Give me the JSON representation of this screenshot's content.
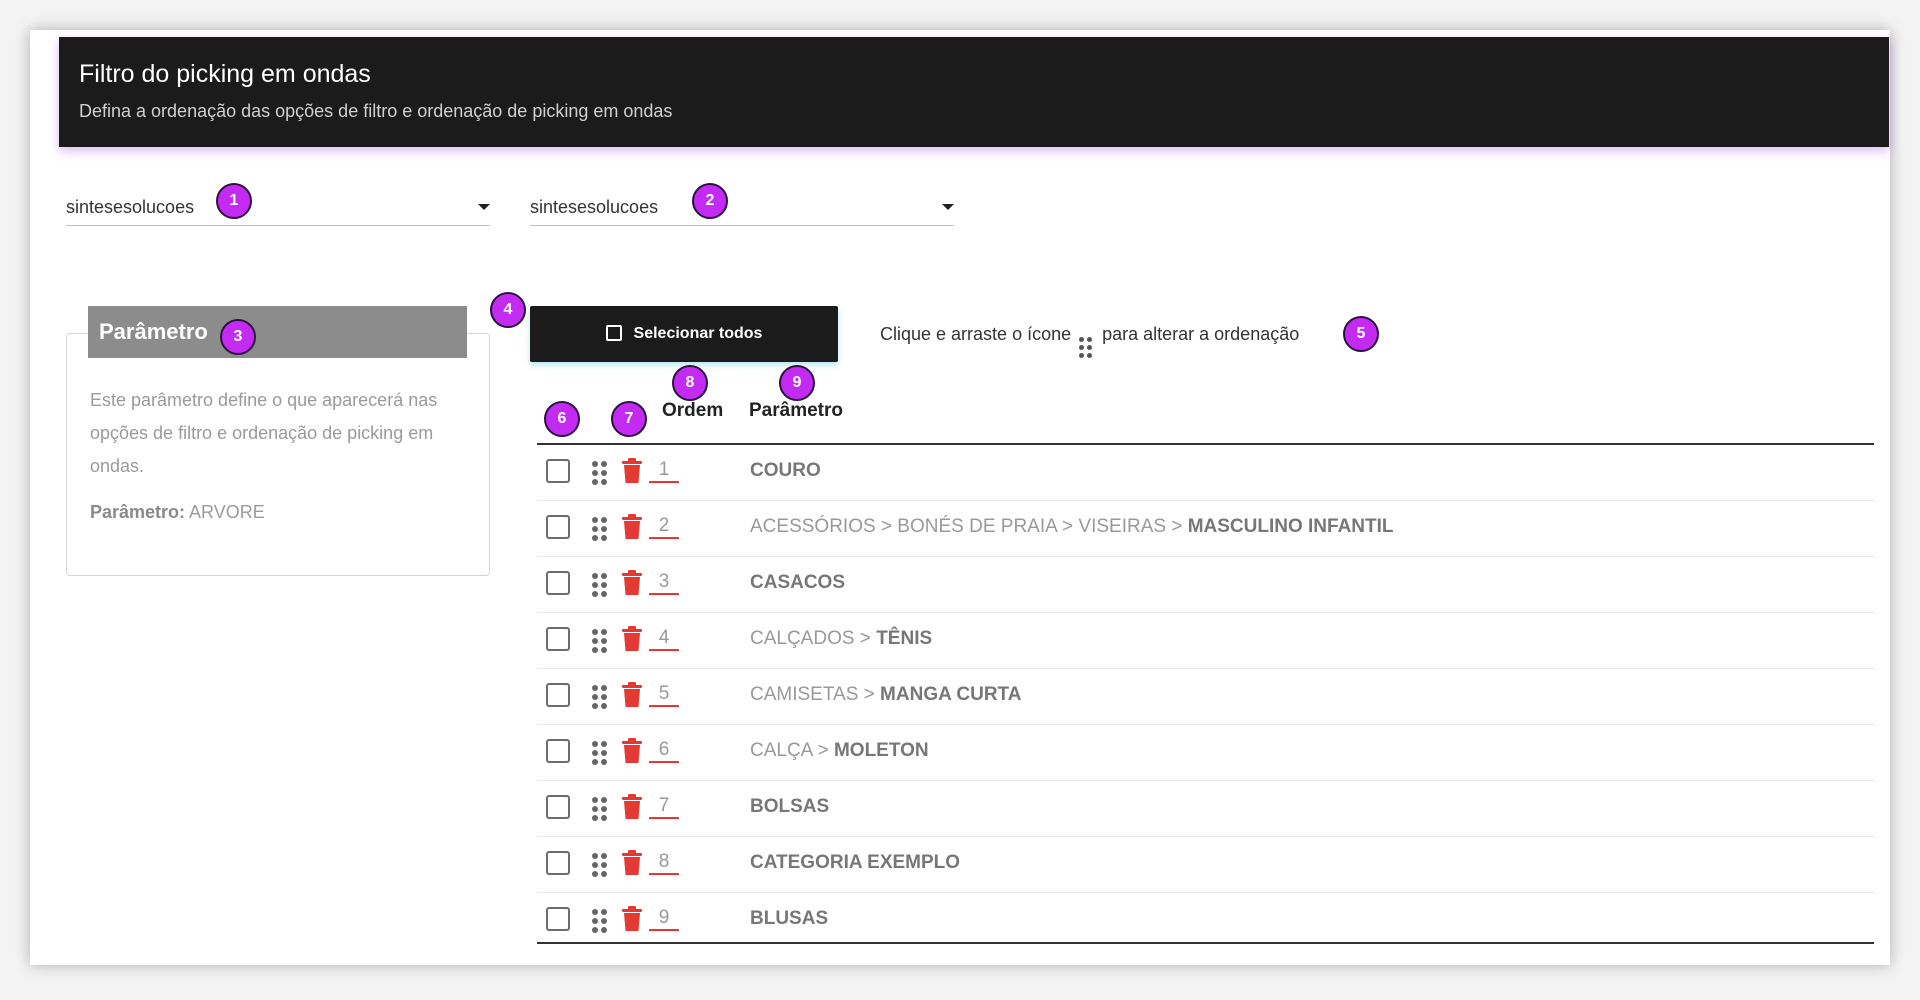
{
  "header": {
    "title": "Filtro do picking em ondas",
    "subtitle": "Defina a ordenação das opções de filtro e ordenação de picking em ondas"
  },
  "selects": [
    {
      "value": "sintesesolucoes"
    },
    {
      "value": "sintesesolucoes"
    }
  ],
  "badges": [
    "1",
    "2",
    "3",
    "4",
    "5",
    "6",
    "7",
    "8",
    "9"
  ],
  "param_card": {
    "title": "Parâmetro",
    "description": "Este parâmetro define o que aparecerá nas opções de filtro e ordenação de picking em ondas.",
    "kv_label": "Parâmetro:",
    "kv_value": " ARVORE"
  },
  "select_all_label": "Selecionar todos",
  "hint": {
    "before": "Clique e arraste o ícone",
    "after": "para alterar a ordenação"
  },
  "columns": {
    "ordem": "Ordem",
    "parametro": "Parâmetro"
  },
  "rows": [
    {
      "order": "1",
      "path": "",
      "leaf": "COURO"
    },
    {
      "order": "2",
      "path": "ACESSÓRIOS > BONÉS DE PRAIA > VISEIRAS > ",
      "leaf": "MASCULINO INFANTIL"
    },
    {
      "order": "3",
      "path": "",
      "leaf": "CASACOS"
    },
    {
      "order": "4",
      "path": "CALÇADOS > ",
      "leaf": "TÊNIS"
    },
    {
      "order": "5",
      "path": "CAMISETAS > ",
      "leaf": "MANGA CURTA"
    },
    {
      "order": "6",
      "path": "CALÇA > ",
      "leaf": "MOLETON"
    },
    {
      "order": "7",
      "path": "",
      "leaf": "BOLSAS"
    },
    {
      "order": "8",
      "path": "",
      "leaf": "CATEGORIA EXEMPLO"
    },
    {
      "order": "9",
      "path": "",
      "leaf": "BLUSAS"
    }
  ],
  "colors": {
    "header_bg": "#1b1b1b",
    "badge": "#c42bf2",
    "trash": "#e53935"
  }
}
